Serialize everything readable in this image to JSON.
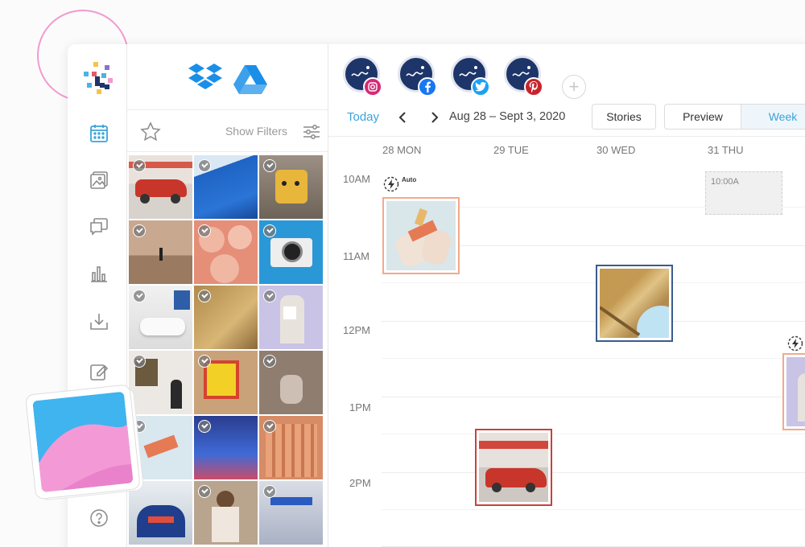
{
  "media_panel": {
    "show_filters_label": "Show Filters"
  },
  "calendar": {
    "today_label": "Today",
    "date_range": "Aug 28 – Sept 3, 2020",
    "stories_label": "Stories",
    "preview_label": "Preview",
    "week_label": "Week",
    "days": [
      "28 MON",
      "29 TUE",
      "30 WED",
      "31 THU"
    ],
    "hours": [
      "10AM",
      "11AM",
      "12PM",
      "1PM",
      "2PM"
    ],
    "auto_label": "Auto",
    "auto_label_partial": "A",
    "placeholder_time": "10:00A"
  },
  "accounts": [
    {
      "platform": "instagram",
      "badge_icon": "instagram-icon",
      "badge_color": "#d62976"
    },
    {
      "platform": "facebook",
      "badge_icon": "facebook-icon",
      "badge_color": "#1877f2"
    },
    {
      "platform": "twitter",
      "badge_icon": "twitter-icon",
      "badge_color": "#1da1f2"
    },
    {
      "platform": "pinterest",
      "badge_icon": "pinterest-icon",
      "badge_color": "#c8232c"
    }
  ],
  "colors": {
    "accent": "#3ba3d9",
    "avatar_bg": "#1d3569",
    "instagram_border": "#f2a98d",
    "facebook_border": "#3b5b8f",
    "pinterest_border": "#c8423a"
  }
}
